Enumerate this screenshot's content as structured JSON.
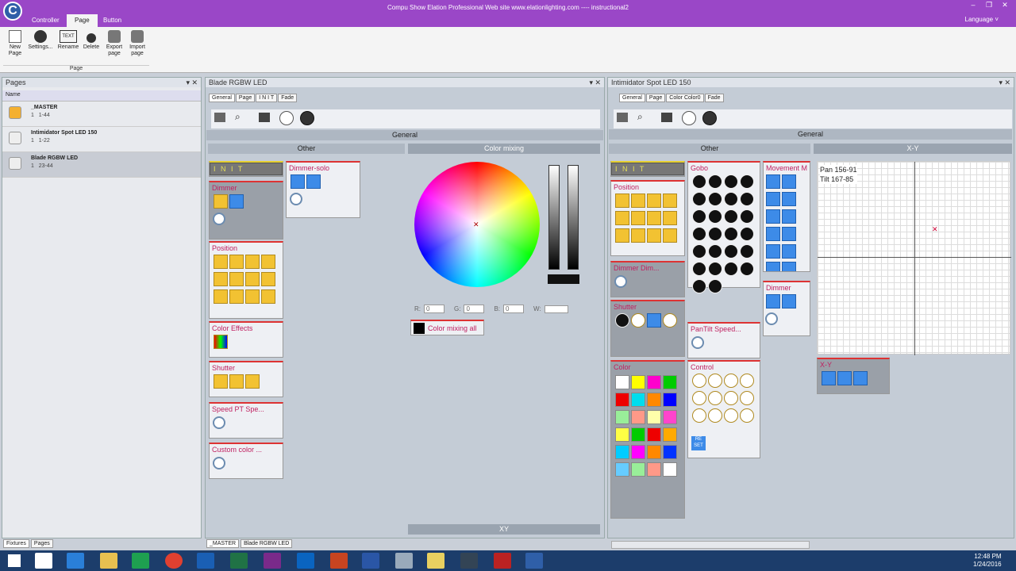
{
  "title": "Compu Show    Elation Professional    Web site  www.elationlighting.com ---- instructional2",
  "menu": {
    "tabs": [
      "Controller",
      "Page",
      "Button"
    ],
    "language": "Language ˅"
  },
  "ribbon": {
    "buttons": [
      "New Page",
      "Settings...",
      "Rename",
      "Delete",
      "Export page",
      "Import page"
    ],
    "group": "Page",
    "rename_icon": "TEXT"
  },
  "pages_panel": {
    "title": "Pages",
    "name_col": "Name",
    "rows": [
      {
        "name": "_MASTER",
        "num": "1",
        "range": "1-44"
      },
      {
        "name": "Intimidator Spot LED 150",
        "num": "1",
        "range": "1-22"
      },
      {
        "name": "Blade RGBW LED",
        "num": "1",
        "range": "23-44"
      }
    ],
    "bottom_tabs": [
      "Fixtures",
      "Pages"
    ]
  },
  "blade": {
    "title": "Blade RGBW LED",
    "tabs": [
      "General",
      "Page",
      "I N I T",
      "Fade"
    ],
    "bar": "General",
    "other": "Other",
    "color_mixing": "Color mixing",
    "xy": "XY",
    "init": "I N I T",
    "dimmer": "Dimmer",
    "dimmer_solo": "Dimmer-solo",
    "position": "Position",
    "color_effects": "Color Effects",
    "shutter": "Shutter",
    "speed": "Speed PT Spe...",
    "custom": "Custom color ...",
    "rgb": {
      "r": "R:",
      "g": "G:",
      "b": "B:",
      "w": "W:",
      "r_val": "0",
      "g_val": "0",
      "b_val": "0"
    },
    "color_all": "Color mixing all",
    "bottom_tabs": [
      "_MASTER",
      "Blade RGBW LED"
    ]
  },
  "spot": {
    "title": "Intimidator Spot LED 150",
    "tabs": [
      "General",
      "Page",
      "Color Color0",
      "Fade"
    ],
    "bar": "General",
    "other": "Other",
    "xy_title": "X-Y",
    "init": "I N I T",
    "gobo": "Gobo",
    "movement": "Movement M",
    "position": "Position",
    "dimmer": "Dimmer Dim...",
    "dimmer2": "Dimmer",
    "shutter": "Shutter",
    "pantilt": "PanTilt Speed...",
    "color": "Color",
    "control": "Control",
    "reset": "RE SET",
    "xy_card": "X-Y",
    "pan": "Pan 156-91",
    "tilt": "Tilt 167-85"
  },
  "colors": {
    "swatches": [
      "#ffffff",
      "#ffff00",
      "#ff00cc",
      "#00cc00",
      "#ee0000",
      "#00ddee",
      "#ff8800",
      "#0000ff",
      "#99ee99",
      "#ff9988",
      "#ffffaa",
      "#ff44cc",
      "#ffff44",
      "#00cc00",
      "#ee0000",
      "#ffaa00",
      "#00ccff",
      "#ff00ff",
      "#ff8800",
      "#0033ff",
      "#66ccff",
      "#99ee99",
      "#ff9988",
      "#ffffff"
    ]
  },
  "taskbar": {
    "time": "12:48 PM",
    "date": "1/24/2016"
  }
}
